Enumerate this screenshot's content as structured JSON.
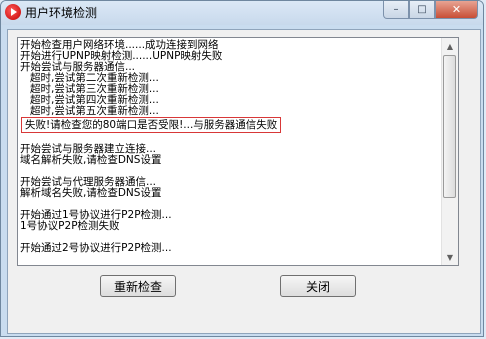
{
  "window": {
    "title": "用户环境检测",
    "minimize_glyph": "–",
    "maximize_glyph": "□",
    "close_glyph": "✕"
  },
  "log": {
    "lines": [
      {
        "text": "开始检查用户网络环境......成功连接到网络",
        "indent": false
      },
      {
        "text": "开始进行UPNP映射检测......UPNP映射失败",
        "indent": false
      },
      {
        "text": "开始尝试与服务器通信...",
        "indent": false
      },
      {
        "text": "超时,尝试第二次重新检测...",
        "indent": true
      },
      {
        "text": "超时,尝试第三次重新检测...",
        "indent": true
      },
      {
        "text": "超时,尝试第四次重新检测...",
        "indent": true
      },
      {
        "text": "超时,尝试第五次重新检测...",
        "indent": true
      },
      {
        "text": "失败!请检查您的80端口是否受限!...与服务器通信失败",
        "indent": true,
        "highlight": true
      },
      {
        "text": "",
        "gap": true
      },
      {
        "text": "开始尝试与服务器建立连接...",
        "indent": false
      },
      {
        "text": "域名解析失败,请检查DNS设置",
        "indent": false
      },
      {
        "text": "",
        "gap": true
      },
      {
        "text": "开始尝试与代理服务器通信...",
        "indent": false
      },
      {
        "text": "解析域名失败,请检查DNS设置",
        "indent": false
      },
      {
        "text": "",
        "gap": true
      },
      {
        "text": "开始通过1号协议进行P2P检测...",
        "indent": false
      },
      {
        "text": "1号协议P2P检测失败",
        "indent": false
      },
      {
        "text": "",
        "gap": true
      },
      {
        "text": "开始通过2号协议进行P2P检测...",
        "indent": false
      }
    ]
  },
  "buttons": {
    "recheck_label": "重新检查",
    "close_label": "关闭"
  },
  "scrollbar": {
    "up_glyph": "▲",
    "down_glyph": "▼"
  },
  "colors": {
    "highlight_border": "#d83838"
  }
}
